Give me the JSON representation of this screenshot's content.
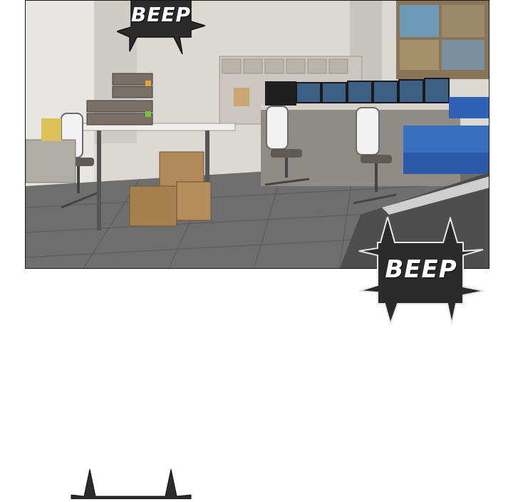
{
  "panel": {
    "scene": "office-control-room"
  },
  "sound_effects": [
    {
      "text": "BEEP"
    },
    {
      "text": "BEEP"
    }
  ],
  "colors": {
    "bubble_fill": "#2b2b2b",
    "bubble_text": "#ffffff",
    "floor": "#6f6f6f",
    "wall": "#d9d6d2",
    "box_cardboard": "#b08a5a",
    "crate_blue": "#3a6fbf"
  }
}
